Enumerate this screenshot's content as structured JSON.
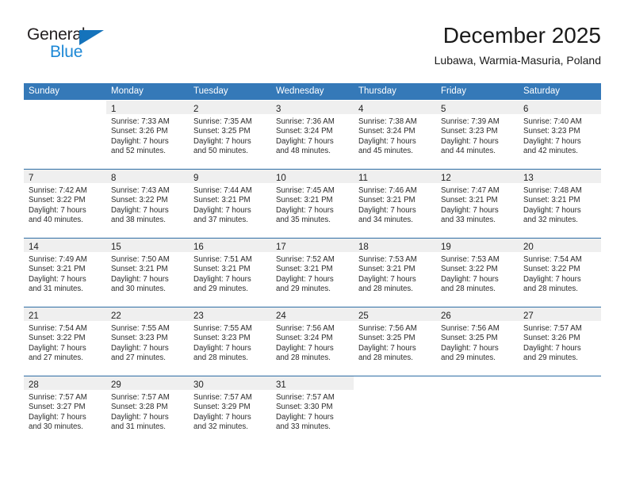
{
  "brand": {
    "name_top": "General",
    "name_bottom": "Blue",
    "accent_color": "#1573bb",
    "blue_text_color": "#1c88d6"
  },
  "header": {
    "title": "December 2025",
    "subtitle": "Lubawa, Warmia-Masuria, Poland"
  },
  "calendar": {
    "header_bg": "#3579b8",
    "row_divider_color": "#2e6da4",
    "daynum_band_bg": "#efefef",
    "weekday_headers": [
      "Sunday",
      "Monday",
      "Tuesday",
      "Wednesday",
      "Thursday",
      "Friday",
      "Saturday"
    ],
    "weeks": [
      [
        {
          "day": "",
          "lines": []
        },
        {
          "day": "1",
          "lines": [
            "Sunrise: 7:33 AM",
            "Sunset: 3:26 PM",
            "Daylight: 7 hours",
            "and 52 minutes."
          ]
        },
        {
          "day": "2",
          "lines": [
            "Sunrise: 7:35 AM",
            "Sunset: 3:25 PM",
            "Daylight: 7 hours",
            "and 50 minutes."
          ]
        },
        {
          "day": "3",
          "lines": [
            "Sunrise: 7:36 AM",
            "Sunset: 3:24 PM",
            "Daylight: 7 hours",
            "and 48 minutes."
          ]
        },
        {
          "day": "4",
          "lines": [
            "Sunrise: 7:38 AM",
            "Sunset: 3:24 PM",
            "Daylight: 7 hours",
            "and 45 minutes."
          ]
        },
        {
          "day": "5",
          "lines": [
            "Sunrise: 7:39 AM",
            "Sunset: 3:23 PM",
            "Daylight: 7 hours",
            "and 44 minutes."
          ]
        },
        {
          "day": "6",
          "lines": [
            "Sunrise: 7:40 AM",
            "Sunset: 3:23 PM",
            "Daylight: 7 hours",
            "and 42 minutes."
          ]
        }
      ],
      [
        {
          "day": "7",
          "lines": [
            "Sunrise: 7:42 AM",
            "Sunset: 3:22 PM",
            "Daylight: 7 hours",
            "and 40 minutes."
          ]
        },
        {
          "day": "8",
          "lines": [
            "Sunrise: 7:43 AM",
            "Sunset: 3:22 PM",
            "Daylight: 7 hours",
            "and 38 minutes."
          ]
        },
        {
          "day": "9",
          "lines": [
            "Sunrise: 7:44 AM",
            "Sunset: 3:21 PM",
            "Daylight: 7 hours",
            "and 37 minutes."
          ]
        },
        {
          "day": "10",
          "lines": [
            "Sunrise: 7:45 AM",
            "Sunset: 3:21 PM",
            "Daylight: 7 hours",
            "and 35 minutes."
          ]
        },
        {
          "day": "11",
          "lines": [
            "Sunrise: 7:46 AM",
            "Sunset: 3:21 PM",
            "Daylight: 7 hours",
            "and 34 minutes."
          ]
        },
        {
          "day": "12",
          "lines": [
            "Sunrise: 7:47 AM",
            "Sunset: 3:21 PM",
            "Daylight: 7 hours",
            "and 33 minutes."
          ]
        },
        {
          "day": "13",
          "lines": [
            "Sunrise: 7:48 AM",
            "Sunset: 3:21 PM",
            "Daylight: 7 hours",
            "and 32 minutes."
          ]
        }
      ],
      [
        {
          "day": "14",
          "lines": [
            "Sunrise: 7:49 AM",
            "Sunset: 3:21 PM",
            "Daylight: 7 hours",
            "and 31 minutes."
          ]
        },
        {
          "day": "15",
          "lines": [
            "Sunrise: 7:50 AM",
            "Sunset: 3:21 PM",
            "Daylight: 7 hours",
            "and 30 minutes."
          ]
        },
        {
          "day": "16",
          "lines": [
            "Sunrise: 7:51 AM",
            "Sunset: 3:21 PM",
            "Daylight: 7 hours",
            "and 29 minutes."
          ]
        },
        {
          "day": "17",
          "lines": [
            "Sunrise: 7:52 AM",
            "Sunset: 3:21 PM",
            "Daylight: 7 hours",
            "and 29 minutes."
          ]
        },
        {
          "day": "18",
          "lines": [
            "Sunrise: 7:53 AM",
            "Sunset: 3:21 PM",
            "Daylight: 7 hours",
            "and 28 minutes."
          ]
        },
        {
          "day": "19",
          "lines": [
            "Sunrise: 7:53 AM",
            "Sunset: 3:22 PM",
            "Daylight: 7 hours",
            "and 28 minutes."
          ]
        },
        {
          "day": "20",
          "lines": [
            "Sunrise: 7:54 AM",
            "Sunset: 3:22 PM",
            "Daylight: 7 hours",
            "and 28 minutes."
          ]
        }
      ],
      [
        {
          "day": "21",
          "lines": [
            "Sunrise: 7:54 AM",
            "Sunset: 3:22 PM",
            "Daylight: 7 hours",
            "and 27 minutes."
          ]
        },
        {
          "day": "22",
          "lines": [
            "Sunrise: 7:55 AM",
            "Sunset: 3:23 PM",
            "Daylight: 7 hours",
            "and 27 minutes."
          ]
        },
        {
          "day": "23",
          "lines": [
            "Sunrise: 7:55 AM",
            "Sunset: 3:23 PM",
            "Daylight: 7 hours",
            "and 28 minutes."
          ]
        },
        {
          "day": "24",
          "lines": [
            "Sunrise: 7:56 AM",
            "Sunset: 3:24 PM",
            "Daylight: 7 hours",
            "and 28 minutes."
          ]
        },
        {
          "day": "25",
          "lines": [
            "Sunrise: 7:56 AM",
            "Sunset: 3:25 PM",
            "Daylight: 7 hours",
            "and 28 minutes."
          ]
        },
        {
          "day": "26",
          "lines": [
            "Sunrise: 7:56 AM",
            "Sunset: 3:25 PM",
            "Daylight: 7 hours",
            "and 29 minutes."
          ]
        },
        {
          "day": "27",
          "lines": [
            "Sunrise: 7:57 AM",
            "Sunset: 3:26 PM",
            "Daylight: 7 hours",
            "and 29 minutes."
          ]
        }
      ],
      [
        {
          "day": "28",
          "lines": [
            "Sunrise: 7:57 AM",
            "Sunset: 3:27 PM",
            "Daylight: 7 hours",
            "and 30 minutes."
          ]
        },
        {
          "day": "29",
          "lines": [
            "Sunrise: 7:57 AM",
            "Sunset: 3:28 PM",
            "Daylight: 7 hours",
            "and 31 minutes."
          ]
        },
        {
          "day": "30",
          "lines": [
            "Sunrise: 7:57 AM",
            "Sunset: 3:29 PM",
            "Daylight: 7 hours",
            "and 32 minutes."
          ]
        },
        {
          "day": "31",
          "lines": [
            "Sunrise: 7:57 AM",
            "Sunset: 3:30 PM",
            "Daylight: 7 hours",
            "and 33 minutes."
          ]
        },
        {
          "day": "",
          "lines": []
        },
        {
          "day": "",
          "lines": []
        },
        {
          "day": "",
          "lines": []
        }
      ]
    ]
  }
}
